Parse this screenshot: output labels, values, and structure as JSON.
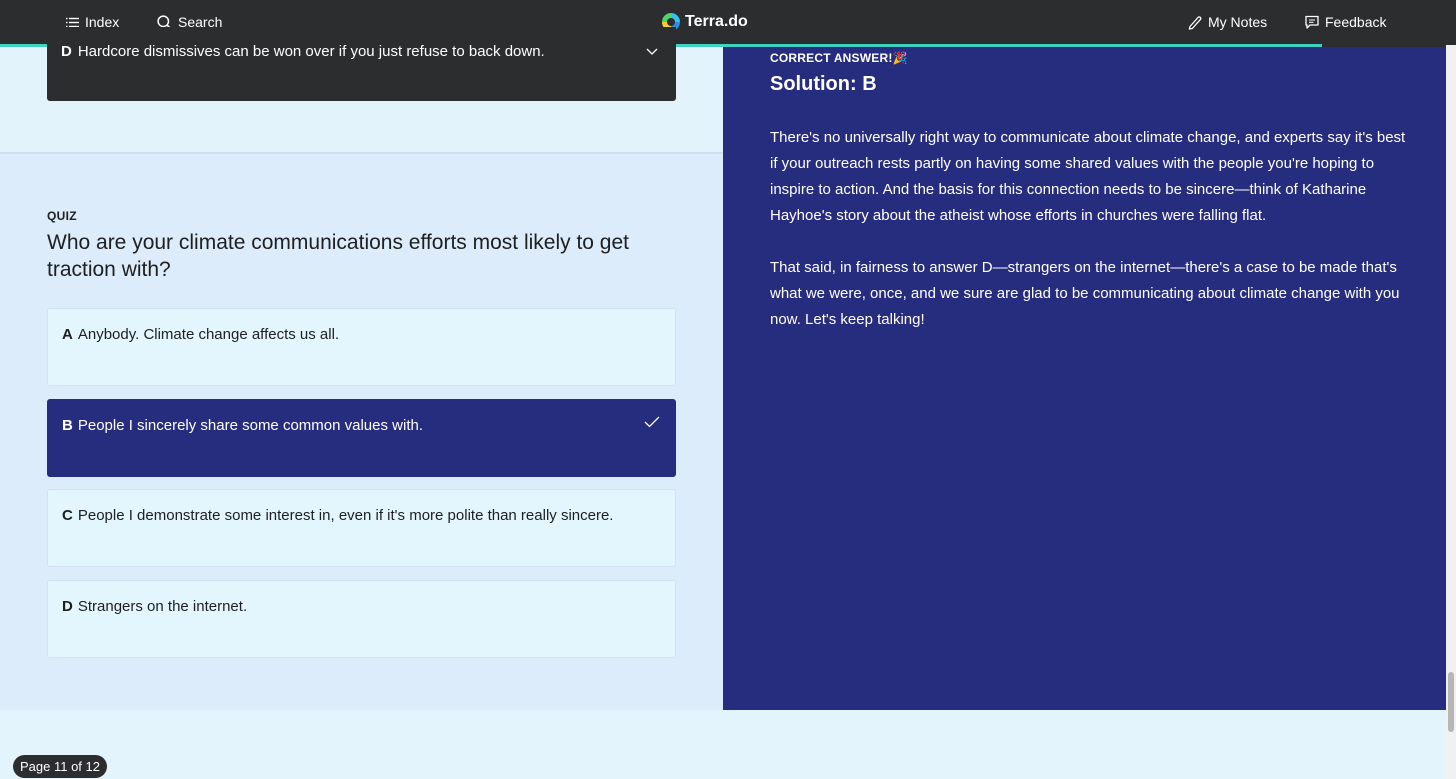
{
  "topbar": {
    "index_label": "Index",
    "search_label": "Search",
    "brand": "Terra.do",
    "notes_label": "My Notes",
    "feedback_label": "Feedback",
    "progress_fraction": 0.914
  },
  "previous_question": {
    "letter": "D",
    "text": "Hardcore dismissives can be won over if you just refuse to back down."
  },
  "quiz": {
    "label": "QUIZ",
    "question": "Who are your climate communications efforts most likely to get traction with?",
    "options": [
      {
        "letter": "A",
        "text": "Anybody. Climate change affects us all."
      },
      {
        "letter": "B",
        "text": "People I sincerely share some common values with."
      },
      {
        "letter": "C",
        "text": "People I demonstrate some interest in, even if it's more polite than really sincere."
      },
      {
        "letter": "D",
        "text": "Strangers on the internet."
      }
    ],
    "selected_option": "B"
  },
  "solution": {
    "correct_label": "CORRECT ANSWER!",
    "title": "Solution: B",
    "paragraphs": [
      "There's no universally right way to communicate about climate change, and experts say it's best if your outreach rests partly on having some shared values with the people you're hoping to inspire to action. And the basis for this connection needs to be sincere—think of Katharine Hayhoe's story about the atheist whose efforts in churches were falling flat.",
      "That said, in fairness to answer D—strangers on the internet—there's a case to be made that's what we were, once, and we sure are glad to be communicating about climate change with you now. Let's keep talking!"
    ]
  },
  "pagination": {
    "label": "Page 11 of 12"
  },
  "colors": {
    "topbar": "#2b2d2f",
    "progress": "#3dd2c2",
    "solution_panel": "#272d7e",
    "left_panel": "#ddecfa"
  }
}
